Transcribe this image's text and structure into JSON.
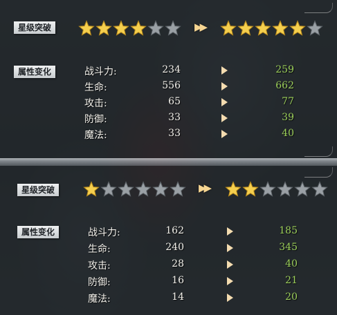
{
  "sections": [
    {
      "star_label": "星级突破",
      "attr_label": "属性变化",
      "stars_before": {
        "filled": 4,
        "total": 6
      },
      "stars_after": {
        "filled": 5,
        "total": 6
      },
      "stats": [
        {
          "name": "战斗力:",
          "old": "234",
          "new": "259"
        },
        {
          "name": "生命:",
          "old": "556",
          "new": "662"
        },
        {
          "name": "攻击:",
          "old": "65",
          "new": "77"
        },
        {
          "name": "防御:",
          "old": "33",
          "new": "39"
        },
        {
          "name": "魔法:",
          "old": "33",
          "new": "40"
        }
      ]
    },
    {
      "star_label": "星级突破",
      "attr_label": "属性变化",
      "stars_before": {
        "filled": 1,
        "total": 6
      },
      "stars_after": {
        "filled": 2,
        "total": 6
      },
      "stats": [
        {
          "name": "战斗力:",
          "old": "162",
          "new": "185"
        },
        {
          "name": "生命:",
          "old": "240",
          "new": "345"
        },
        {
          "name": "攻击:",
          "old": "28",
          "new": "40"
        },
        {
          "name": "防御:",
          "old": "16",
          "new": "21"
        },
        {
          "name": "魔法:",
          "old": "14",
          "new": "20"
        }
      ]
    }
  ],
  "colors": {
    "star_filled": "#f5cf4e",
    "star_empty": "#9aa0a5",
    "stat_new": "#9ccf5a",
    "arrow": "#f4dcb0"
  },
  "icons": {
    "arrow_double": "fast-forward-icon",
    "arrow_single": "play-arrow-icon",
    "star": "star-icon"
  }
}
